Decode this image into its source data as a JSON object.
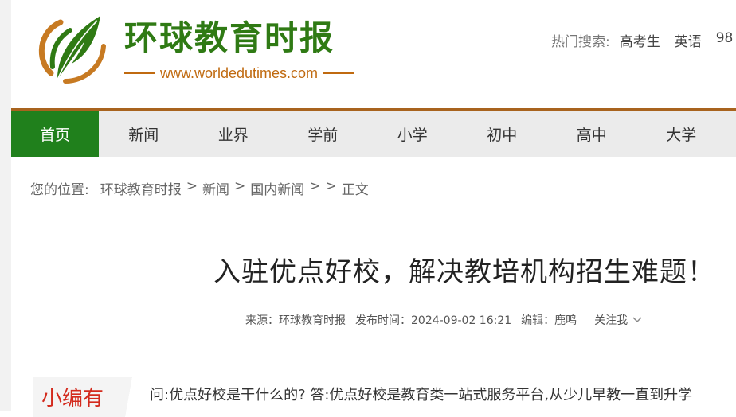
{
  "header": {
    "site_name": "环球教育时报",
    "site_url": "www.worldedutimes.com",
    "hot_search_label": "热门搜索:",
    "hot_search_items": [
      "高考生",
      "英语",
      "98"
    ]
  },
  "nav": {
    "items": [
      "首页",
      "新闻",
      "业界",
      "学前",
      "小学",
      "初中",
      "高中",
      "大学"
    ],
    "active": "首页"
  },
  "breadcrumb": {
    "label": "您的位置:",
    "items": [
      "环球教育时报",
      ">",
      "新闻",
      ">",
      "国内新闻",
      ">",
      ">",
      "正文"
    ]
  },
  "article": {
    "title": "入驻优点好校，解决教培机构招生难题！",
    "source": "来源：环球教育时报",
    "published": "发布时间：2024-09-02 16:21",
    "editor": "编辑：鹿鸣",
    "follow_label": "关注我",
    "editor_tag": "小编有",
    "summary": "问:优点好校是干什么的? 答:优点好校是教育类一站式服务平台,从少儿早教一直到升学"
  },
  "colors": {
    "brand_green": "#2f7a14",
    "nav_active": "#20801c",
    "url_orange": "#c06a10",
    "tag_red": "#d32a1d"
  }
}
